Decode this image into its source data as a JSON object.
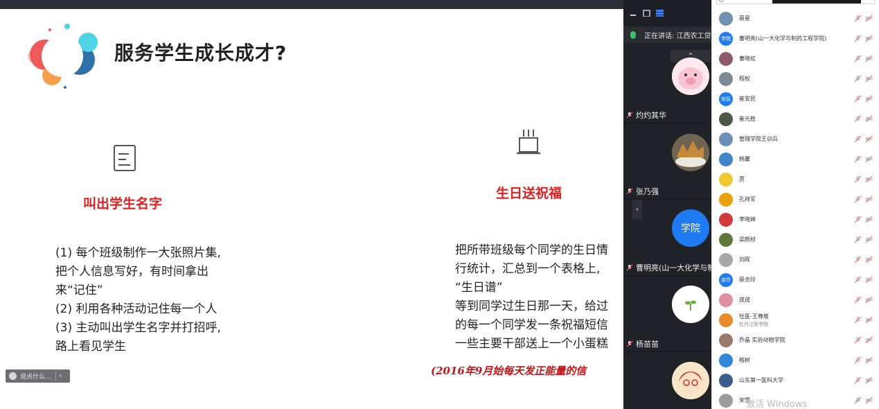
{
  "slide": {
    "title": "服务学生成长成才?",
    "left": {
      "heading": "叫出学生名字",
      "lines": [
        "(1) 每个班级制作一大张照片集,",
        "把个人信息写好，有时间拿出",
        "来“记住”",
        "(2) 利用各种活动记住每一个人",
        "(3) 主动叫出学生名字并打招呼,",
        "路上看见学生"
      ]
    },
    "right": {
      "heading": "生日送祝福",
      "lines": [
        "把所带班级每个同学的生日情",
        "行统计，汇总到一个表格上,",
        "“生日谱”",
        "等到同学过生日那一天，给过",
        "的每一个同学发一条祝福短信",
        "一些主要干部送上一个小蛋糕"
      ]
    },
    "footnote": "(2016年9月始每天发正能量的信",
    "chat_placeholder": "说点什么..."
  },
  "video": {
    "speaking": "正在讲话: 江西农工贷",
    "tiles": [
      {
        "name": "灼灼其华",
        "avatar": "pig"
      },
      {
        "name": "张乃强",
        "avatar": "photo-food"
      },
      {
        "name": "曹明亮(山一大化学与制",
        "avatar": "text",
        "avatar_text": "学院"
      },
      {
        "name": "杨苗苗",
        "avatar": "sprout"
      },
      {
        "name": "",
        "avatar": "cartoon-girl"
      }
    ]
  },
  "participants": [
    {
      "name": "蔡星",
      "sub": "",
      "avatar": "photo",
      "color": "#6f8fb0"
    },
    {
      "name": "曹明亮(山一大化学与制药工程学院)",
      "sub": "",
      "avatar": "text",
      "text": "学院",
      "color": "#1e7bf2"
    },
    {
      "name": "曹晓虹",
      "sub": "",
      "avatar": "photo",
      "color": "#8e5a6a"
    },
    {
      "name": "程权",
      "sub": "",
      "avatar": "photo",
      "color": "#7b8a97"
    },
    {
      "name": "崔安民",
      "sub": "",
      "avatar": "text",
      "text": "安民",
      "color": "#1e7bf2"
    },
    {
      "name": "崔元胜",
      "sub": "",
      "avatar": "photo",
      "color": "#4b5a44"
    },
    {
      "name": "管理学院王训兵",
      "sub": "",
      "avatar": "photo",
      "color": "#6a8fb8"
    },
    {
      "name": "韩馨",
      "sub": "",
      "avatar": "photo",
      "color": "#3e86c9"
    },
    {
      "name": "贾",
      "sub": "",
      "avatar": "photo",
      "color": "#f0c930"
    },
    {
      "name": "孔祥军",
      "sub": "",
      "avatar": "photo",
      "color": "#e8a20f"
    },
    {
      "name": "李晓婷",
      "sub": "",
      "avatar": "photo",
      "color": "#d23a3a"
    },
    {
      "name": "梁颜桢",
      "sub": "",
      "avatar": "photo",
      "color": "#5d7a3a"
    },
    {
      "name": "刘晖",
      "sub": "",
      "avatar": "photo",
      "color": "#a7a7a7"
    },
    {
      "name": "蔡余玲",
      "sub": "",
      "avatar": "text",
      "text": "余玲",
      "color": "#1e7bf2"
    },
    {
      "name": "荗荗",
      "sub": "",
      "avatar": "photo",
      "color": "#e08fa0"
    },
    {
      "name": "牡医-王尊堆",
      "sub": "牡丹江医学院",
      "avatar": "photo",
      "color": "#e98a2a"
    },
    {
      "name": "乔晶 实验动物学院",
      "sub": "",
      "avatar": "photo",
      "color": "#9a7a6a"
    },
    {
      "name": "榕树",
      "sub": "",
      "avatar": "photo",
      "color": "#2f86d6"
    },
    {
      "name": "山东第一医科大学",
      "sub": "",
      "avatar": "photo",
      "color": "#3b5e8a"
    },
    {
      "name": "宋雪",
      "sub": "",
      "avatar": "photo",
      "color": "#9b9b9b"
    }
  ],
  "watermark": "激活 Windows",
  "colors": {
    "accent_red": "#e21e1e",
    "panel_dark": "#1f2226",
    "avatar_blue": "#1e7bf2"
  }
}
